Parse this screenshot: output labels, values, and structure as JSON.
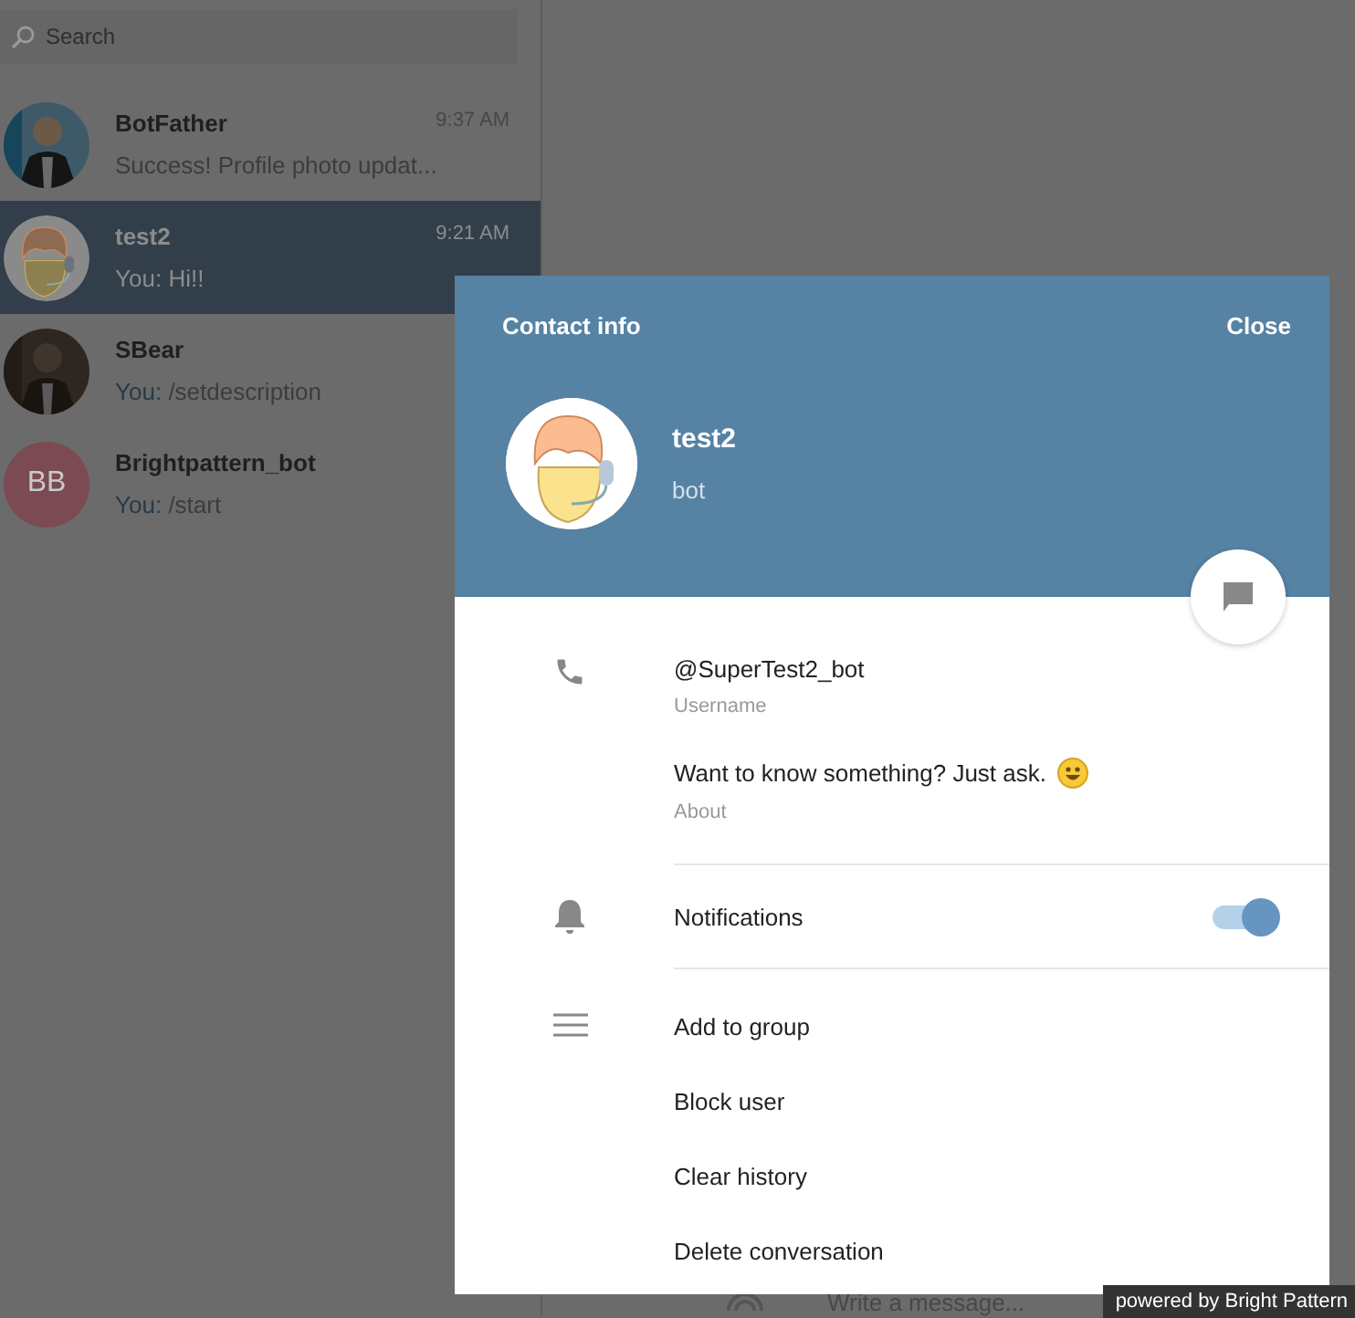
{
  "sidebar": {
    "search": {
      "placeholder": "Search"
    },
    "chats": [
      {
        "name": "BotFather",
        "time": "9:37 AM",
        "preview": "Success! Profile photo updat...",
        "selected": false
      },
      {
        "name": "test2",
        "time": "9:21 AM",
        "sender": "You:",
        "preview": "Hi!!",
        "selected": true,
        "avatar": {
          "kind": "cartoon"
        }
      },
      {
        "name": "SBear",
        "sender": "You:",
        "preview": "/setdescription",
        "selected": false
      },
      {
        "name": "Brightpattern_bot",
        "sender": "You:",
        "preview": "/start",
        "selected": false,
        "avatar": {
          "kind": "initials",
          "initials": "BB",
          "color": "#7b4a53"
        }
      }
    ]
  },
  "composer": {
    "placeholder": "Write a message..."
  },
  "contact_info": {
    "title": "Contact info",
    "close": "Close",
    "name": "test2",
    "status": "bot",
    "details": [
      {
        "kind": "username",
        "value": "@SuperTest2_bot",
        "label": "Username"
      },
      {
        "kind": "about",
        "value": "Want to know something? Just ask.",
        "emoji": true,
        "label": "About"
      }
    ],
    "notifications": {
      "label": "Notifications",
      "on": true
    },
    "actions": [
      "Add to group",
      "Block user",
      "Clear history",
      "Delete conversation"
    ]
  },
  "badge": "powered by Bright Pattern"
}
